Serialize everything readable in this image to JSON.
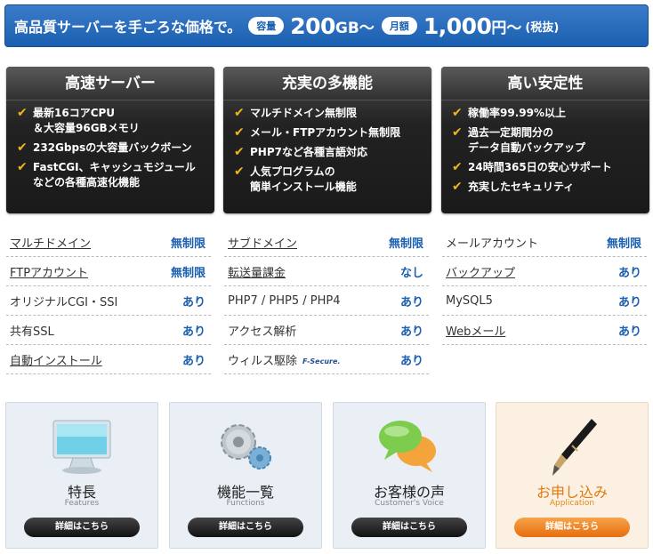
{
  "banner": {
    "lead": "高品質サーバーを手ごろな価格で。",
    "capacity_pill": "容量",
    "capacity_value": "200",
    "capacity_unit": "GB〜",
    "price_pill": "月額",
    "price_value": "1,000",
    "price_unit": "円〜",
    "price_note": "(税抜)"
  },
  "features": [
    {
      "title": "高速サーバー",
      "items": [
        "最新16コアCPU\n＆大容量96GBメモリ",
        "232Gbpsの大容量バックボーン",
        "FastCGI、キャッシュモジュール\nなどの各種高速化機能"
      ]
    },
    {
      "title": "充実の多機能",
      "items": [
        "マルチドメイン無制限",
        "メール・FTPアカウント無制限",
        "PHP7など各種言語対応",
        "人気プログラムの\n簡単インストール機能"
      ]
    },
    {
      "title": "高い安定性",
      "items": [
        "稼働率99.99%以上",
        "過去一定期間分の\nデータ自動バックアップ",
        "24時間365日の安心サポート",
        "充実したセキュリティ"
      ]
    }
  ],
  "specs": {
    "col1": [
      {
        "name": "マルチドメイン",
        "value": "無制限"
      },
      {
        "name": "FTPアカウント",
        "value": "無制限"
      },
      {
        "name": "オリジナルCGI・SSI",
        "value": "あり"
      },
      {
        "name": "共有SSL",
        "value": "あり"
      },
      {
        "name": "自動インストール",
        "value": "あり"
      }
    ],
    "col2": [
      {
        "name": "サブドメイン",
        "value": "無制限"
      },
      {
        "name": "転送量課金",
        "value": "なし"
      },
      {
        "name": "PHP7 / PHP5 / PHP4",
        "value": "あり"
      },
      {
        "name": "アクセス解析",
        "value": "あり"
      },
      {
        "name": "ウィルス駆除",
        "value": "あり",
        "logo": "F-Secure."
      }
    ],
    "col3": [
      {
        "name": "メールアカウント",
        "value": "無制限"
      },
      {
        "name": "バックアップ",
        "value": "あり"
      },
      {
        "name": "MySQL5",
        "value": "あり"
      },
      {
        "name": "Webメール",
        "value": "あり"
      }
    ]
  },
  "cards": [
    {
      "title": "特長",
      "subtitle": "Features",
      "button": "詳細はこちら",
      "icon": "monitor-icon"
    },
    {
      "title": "機能一覧",
      "subtitle": "Functions",
      "button": "詳細はこちら",
      "icon": "gears-icon"
    },
    {
      "title": "お客様の声",
      "subtitle": "Customer's Voice",
      "button": "詳細はこちら",
      "icon": "speech-bubbles-icon"
    },
    {
      "title": "お申し込み",
      "subtitle": "Application",
      "button": "詳細はこちら",
      "icon": "fountain-pen-icon"
    }
  ],
  "colors": {
    "banner": "#1b5fb0",
    "accent_orange": "#e56f0e",
    "check": "#f1b51c",
    "value_blue": "#1b5fb0"
  }
}
